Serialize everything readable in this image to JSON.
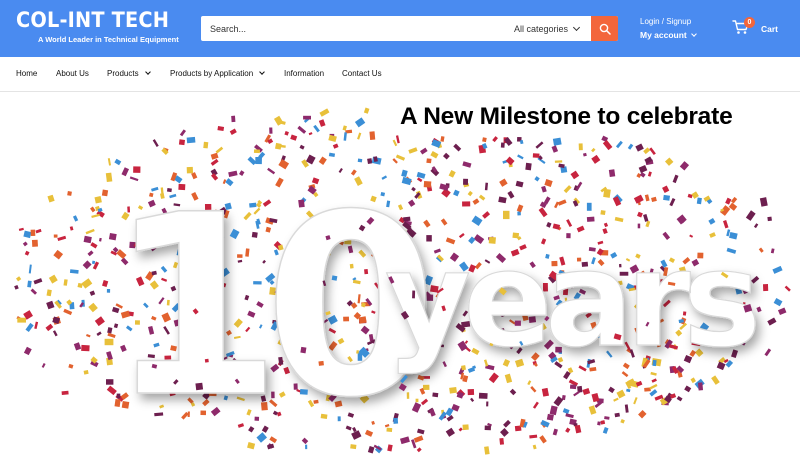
{
  "header": {
    "logo": {
      "name": "COL-INT TECH",
      "tagline": "A World Leader in Technical Equipment"
    },
    "search": {
      "placeholder": "Search...",
      "category": "All categories",
      "button_icon": "search-icon"
    },
    "account": {
      "login_label": "Login / Signup",
      "account_label": "My account"
    },
    "cart": {
      "count": "0",
      "label": "Cart",
      "icon": "cart-icon"
    }
  },
  "nav": {
    "items": [
      {
        "label": "Home"
      },
      {
        "label": "About Us"
      },
      {
        "label": "Products"
      },
      {
        "label": "Products by Application"
      },
      {
        "label": "Information"
      },
      {
        "label": "Contact Us"
      }
    ]
  },
  "hero": {
    "title": "A New Milestone to celebrate",
    "number": "10",
    "word": "years"
  },
  "colors": {
    "header_bg": "#4a8bf0",
    "accent": "#f3663b",
    "confetti": [
      "#c8243f",
      "#e8c03a",
      "#3b8fd6",
      "#8e2a6b",
      "#e2622f",
      "#6d1f4f"
    ]
  }
}
